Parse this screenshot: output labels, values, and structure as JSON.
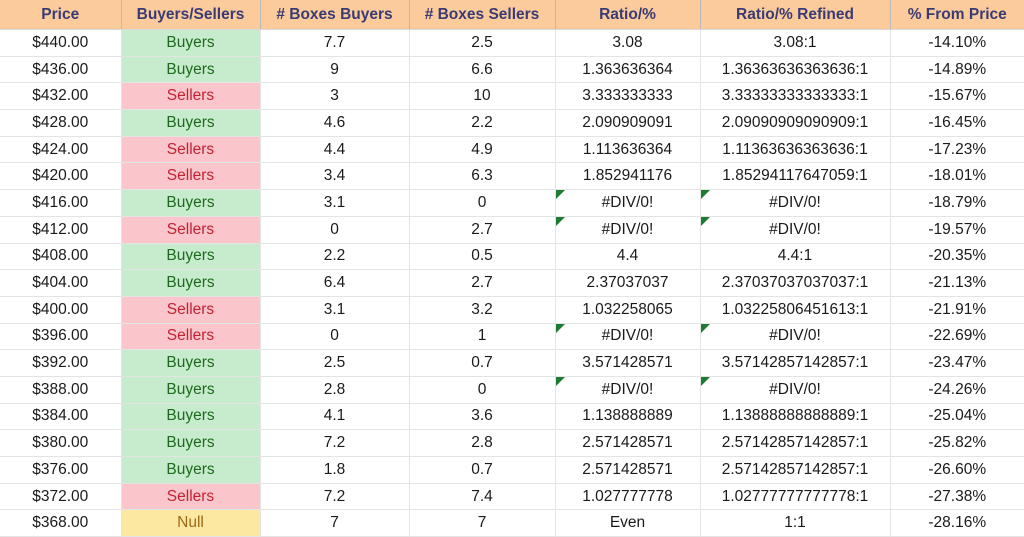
{
  "app": {
    "type": "spreadsheet-table",
    "colors": {
      "header_bg": "#FBCB9C",
      "header_text": "#3B3B73",
      "buyers_bg": "#C7EBCD",
      "buyers_text": "#1D6A1D",
      "sellers_bg": "#FAC5CB",
      "sellers_text": "#C32233",
      "null_bg": "#FCE8A0",
      "null_text": "#9C6A16",
      "error_flag": "#1E7B34",
      "gridline": "#E4E4E4"
    }
  },
  "table": {
    "columns": [
      {
        "key": "price",
        "label": "Price"
      },
      {
        "key": "bs",
        "label": "Buyers/Sellers"
      },
      {
        "key": "boxbuy",
        "label": "# Boxes Buyers"
      },
      {
        "key": "boxsell",
        "label": "# Boxes Sellers"
      },
      {
        "key": "ratio",
        "label": "Ratio/%"
      },
      {
        "key": "ratioref",
        "label": "Ratio/% Refined"
      },
      {
        "key": "frompx",
        "label": "% From Price"
      }
    ],
    "rows": [
      {
        "price": "$440.00",
        "bs": "Buyers",
        "bs_state": "buyers",
        "boxbuy": "7.7",
        "boxsell": "2.5",
        "ratio": "3.08",
        "ratio_error": false,
        "ratioref": "3.08:1",
        "ratioref_error": false,
        "frompx": "-14.10%"
      },
      {
        "price": "$436.00",
        "bs": "Buyers",
        "bs_state": "buyers",
        "boxbuy": "9",
        "boxsell": "6.6",
        "ratio": "1.363636364",
        "ratio_error": false,
        "ratioref": "1.36363636363636:1",
        "ratioref_error": false,
        "frompx": "-14.89%"
      },
      {
        "price": "$432.00",
        "bs": "Sellers",
        "bs_state": "sellers",
        "boxbuy": "3",
        "boxsell": "10",
        "ratio": "3.333333333",
        "ratio_error": false,
        "ratioref": "3.33333333333333:1",
        "ratioref_error": false,
        "frompx": "-15.67%"
      },
      {
        "price": "$428.00",
        "bs": "Buyers",
        "bs_state": "buyers",
        "boxbuy": "4.6",
        "boxsell": "2.2",
        "ratio": "2.090909091",
        "ratio_error": false,
        "ratioref": "2.09090909090909:1",
        "ratioref_error": false,
        "frompx": "-16.45%"
      },
      {
        "price": "$424.00",
        "bs": "Sellers",
        "bs_state": "sellers",
        "boxbuy": "4.4",
        "boxsell": "4.9",
        "ratio": "1.113636364",
        "ratio_error": false,
        "ratioref": "1.11363636363636:1",
        "ratioref_error": false,
        "frompx": "-17.23%"
      },
      {
        "price": "$420.00",
        "bs": "Sellers",
        "bs_state": "sellers",
        "boxbuy": "3.4",
        "boxsell": "6.3",
        "ratio": "1.852941176",
        "ratio_error": false,
        "ratioref": "1.85294117647059:1",
        "ratioref_error": false,
        "frompx": "-18.01%"
      },
      {
        "price": "$416.00",
        "bs": "Buyers",
        "bs_state": "buyers",
        "boxbuy": "3.1",
        "boxsell": "0",
        "ratio": "#DIV/0!",
        "ratio_error": true,
        "ratioref": "#DIV/0!",
        "ratioref_error": true,
        "frompx": "-18.79%"
      },
      {
        "price": "$412.00",
        "bs": "Sellers",
        "bs_state": "sellers",
        "boxbuy": "0",
        "boxsell": "2.7",
        "ratio": "#DIV/0!",
        "ratio_error": true,
        "ratioref": "#DIV/0!",
        "ratioref_error": true,
        "frompx": "-19.57%"
      },
      {
        "price": "$408.00",
        "bs": "Buyers",
        "bs_state": "buyers",
        "boxbuy": "2.2",
        "boxsell": "0.5",
        "ratio": "4.4",
        "ratio_error": false,
        "ratioref": "4.4:1",
        "ratioref_error": false,
        "frompx": "-20.35%"
      },
      {
        "price": "$404.00",
        "bs": "Buyers",
        "bs_state": "buyers",
        "boxbuy": "6.4",
        "boxsell": "2.7",
        "ratio": "2.37037037",
        "ratio_error": false,
        "ratioref": "2.37037037037037:1",
        "ratioref_error": false,
        "frompx": "-21.13%"
      },
      {
        "price": "$400.00",
        "bs": "Sellers",
        "bs_state": "sellers",
        "boxbuy": "3.1",
        "boxsell": "3.2",
        "ratio": "1.032258065",
        "ratio_error": false,
        "ratioref": "1.03225806451613:1",
        "ratioref_error": false,
        "frompx": "-21.91%"
      },
      {
        "price": "$396.00",
        "bs": "Sellers",
        "bs_state": "sellers",
        "boxbuy": "0",
        "boxsell": "1",
        "ratio": "#DIV/0!",
        "ratio_error": true,
        "ratioref": "#DIV/0!",
        "ratioref_error": true,
        "frompx": "-22.69%"
      },
      {
        "price": "$392.00",
        "bs": "Buyers",
        "bs_state": "buyers",
        "boxbuy": "2.5",
        "boxsell": "0.7",
        "ratio": "3.571428571",
        "ratio_error": false,
        "ratioref": "3.57142857142857:1",
        "ratioref_error": false,
        "frompx": "-23.47%"
      },
      {
        "price": "$388.00",
        "bs": "Buyers",
        "bs_state": "buyers",
        "boxbuy": "2.8",
        "boxsell": "0",
        "ratio": "#DIV/0!",
        "ratio_error": true,
        "ratioref": "#DIV/0!",
        "ratioref_error": true,
        "frompx": "-24.26%"
      },
      {
        "price": "$384.00",
        "bs": "Buyers",
        "bs_state": "buyers",
        "boxbuy": "4.1",
        "boxsell": "3.6",
        "ratio": "1.138888889",
        "ratio_error": false,
        "ratioref": "1.13888888888889:1",
        "ratioref_error": false,
        "frompx": "-25.04%"
      },
      {
        "price": "$380.00",
        "bs": "Buyers",
        "bs_state": "buyers",
        "boxbuy": "7.2",
        "boxsell": "2.8",
        "ratio": "2.571428571",
        "ratio_error": false,
        "ratioref": "2.57142857142857:1",
        "ratioref_error": false,
        "frompx": "-25.82%"
      },
      {
        "price": "$376.00",
        "bs": "Buyers",
        "bs_state": "buyers",
        "boxbuy": "1.8",
        "boxsell": "0.7",
        "ratio": "2.571428571",
        "ratio_error": false,
        "ratioref": "2.57142857142857:1",
        "ratioref_error": false,
        "frompx": "-26.60%"
      },
      {
        "price": "$372.00",
        "bs": "Sellers",
        "bs_state": "sellers",
        "boxbuy": "7.2",
        "boxsell": "7.4",
        "ratio": "1.027777778",
        "ratio_error": false,
        "ratioref": "1.02777777777778:1",
        "ratioref_error": false,
        "frompx": "-27.38%"
      },
      {
        "price": "$368.00",
        "bs": "Null",
        "bs_state": "null",
        "boxbuy": "7",
        "boxsell": "7",
        "ratio": "Even",
        "ratio_error": false,
        "ratioref": "1:1",
        "ratioref_error": false,
        "frompx": "-28.16%"
      }
    ]
  }
}
